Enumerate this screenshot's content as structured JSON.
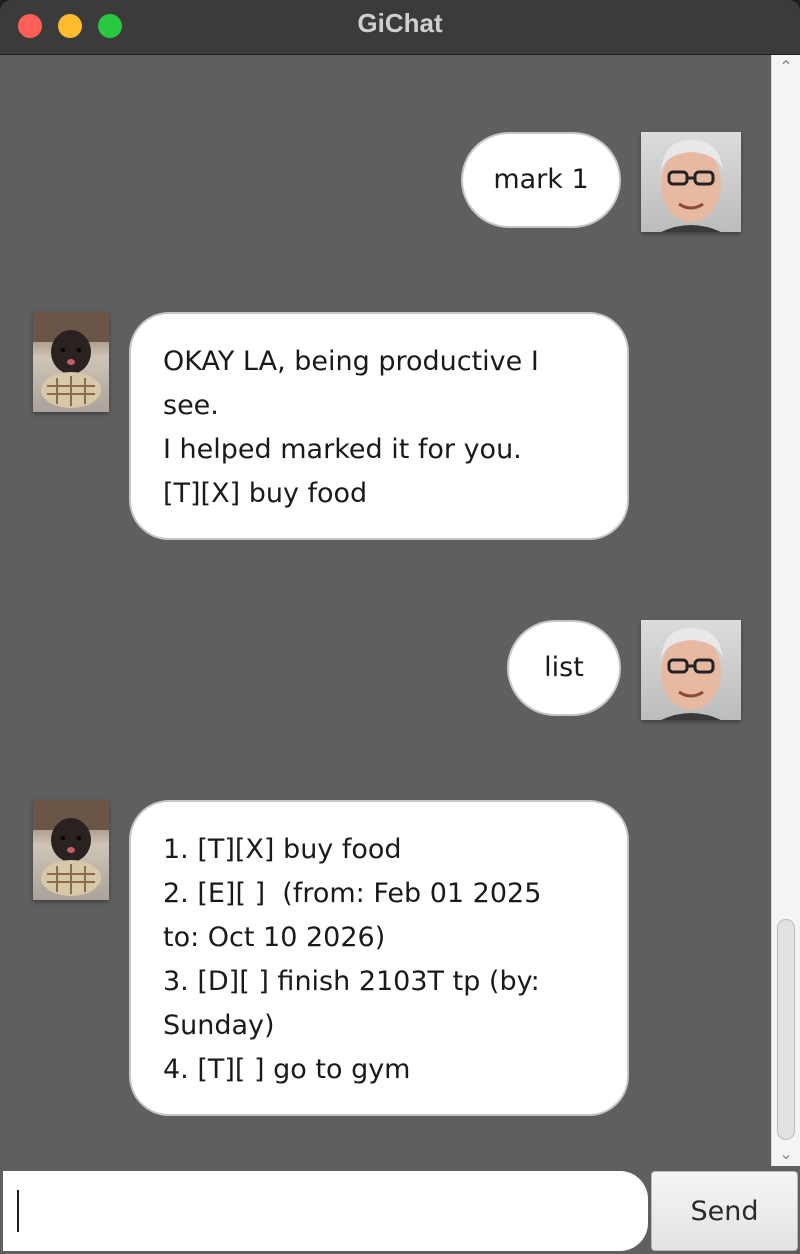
{
  "window": {
    "title": "GiChat"
  },
  "messages": [
    {
      "sender": "user",
      "text": "mark 1"
    },
    {
      "sender": "bot",
      "lines": [
        "OKAY LA, being productive I",
        "see.",
        "I helped marked it for you.",
        "[T][X] buy food"
      ]
    },
    {
      "sender": "user",
      "text": "list"
    },
    {
      "sender": "bot",
      "lines": [
        "1. [T][X] buy food",
        "2. [E][ ]  (from: Feb 01 2025",
        "to: Oct 10 2026)",
        "3. [D][ ] finish 2103T tp (by:",
        "Sunday)",
        "4. [T][ ] go to gym"
      ]
    }
  ],
  "input": {
    "value": "",
    "placeholder": ""
  },
  "send_button": {
    "label": "Send"
  },
  "colors": {
    "background": "#5f5f5f",
    "titlebar": "#3b3b3b",
    "bubble": "#ffffff",
    "close": "#ff5f57",
    "minimize": "#febc2e",
    "maximize": "#28c840"
  },
  "icons": [
    "close-window-icon",
    "minimize-window-icon",
    "maximize-window-icon",
    "scroll-up-icon",
    "scroll-down-icon"
  ]
}
